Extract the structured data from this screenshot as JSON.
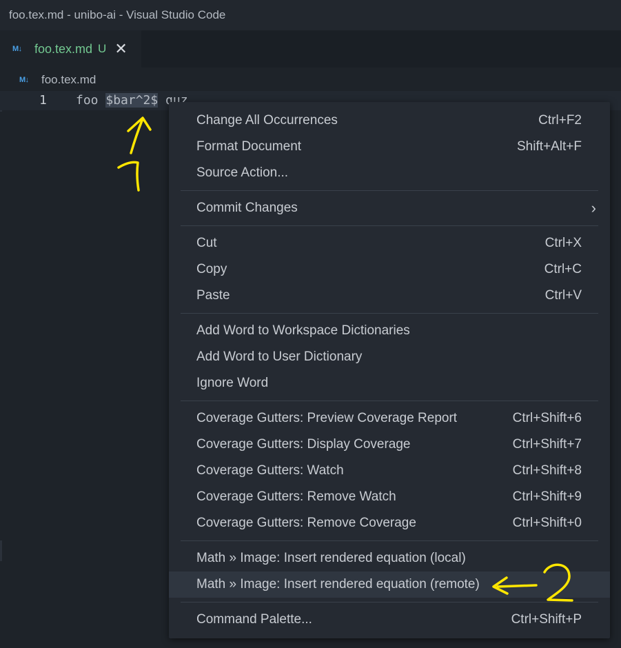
{
  "window": {
    "title": "foo.tex.md - unibo-ai - Visual Studio Code"
  },
  "tab": {
    "icon": "markdown-icon",
    "name": "foo.tex.md",
    "status": "U",
    "close": "✕"
  },
  "breadcrumb": {
    "file": "foo.tex.md"
  },
  "editor": {
    "line_number": "1",
    "code_before": "foo ",
    "code_selected": "$bar^2$",
    "code_after": " quz"
  },
  "menu": {
    "groups": [
      [
        {
          "label": "Change All Occurrences",
          "shortcut": "Ctrl+F2"
        },
        {
          "label": "Format Document",
          "shortcut": "Shift+Alt+F"
        },
        {
          "label": "Source Action...",
          "shortcut": ""
        }
      ],
      [
        {
          "label": "Commit Changes",
          "shortcut": "",
          "submenu": true
        }
      ],
      [
        {
          "label": "Cut",
          "shortcut": "Ctrl+X"
        },
        {
          "label": "Copy",
          "shortcut": "Ctrl+C"
        },
        {
          "label": "Paste",
          "shortcut": "Ctrl+V"
        }
      ],
      [
        {
          "label": "Add Word to Workspace Dictionaries",
          "shortcut": ""
        },
        {
          "label": "Add Word to User Dictionary",
          "shortcut": ""
        },
        {
          "label": "Ignore Word",
          "shortcut": ""
        }
      ],
      [
        {
          "label": "Coverage Gutters: Preview Coverage Report",
          "shortcut": "Ctrl+Shift+6"
        },
        {
          "label": "Coverage Gutters: Display Coverage",
          "shortcut": "Ctrl+Shift+7"
        },
        {
          "label": "Coverage Gutters: Watch",
          "shortcut": "Ctrl+Shift+8"
        },
        {
          "label": "Coverage Gutters: Remove Watch",
          "shortcut": "Ctrl+Shift+9"
        },
        {
          "label": "Coverage Gutters: Remove Coverage",
          "shortcut": "Ctrl+Shift+0"
        }
      ],
      [
        {
          "label": "Math » Image: Insert rendered equation (local)",
          "shortcut": ""
        },
        {
          "label": "Math » Image: Insert rendered equation (remote)",
          "shortcut": "",
          "active": true
        }
      ],
      [
        {
          "label": "Command Palette...",
          "shortcut": "Ctrl+Shift+P"
        }
      ]
    ]
  },
  "annotations": {
    "color": "#ffe600",
    "label_1": "1",
    "label_2": "2"
  },
  "colors": {
    "accent_tab": "#73c991",
    "markdown_icon": "#4aa0e6"
  }
}
